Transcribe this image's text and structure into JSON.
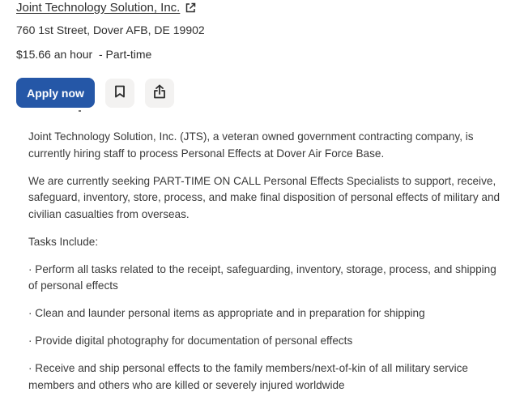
{
  "job": {
    "company": "Joint Technology Solution, Inc.",
    "company_link_icon": "external-link-icon",
    "address": "760 1st Street, Dover AFB, DE 19902",
    "salary": "$15.66 an hour",
    "job_type": " - Part-time"
  },
  "actions": {
    "apply_label": "Apply now",
    "save_icon": "bookmark-icon",
    "share_icon": "share-icon",
    "accent_color": "#2557a7"
  },
  "description": {
    "paragraphs": [
      "Joint Technology Solution, Inc. (JTS), a veteran owned government contracting company, is currently hiring staff to process Personal Effects at Dover Air Force Base.",
      "We are currently seeking PART-TIME ON CALL Personal Effects Specialists to support, receive, safeguard, inventory, store, process, and make final disposition of personal effects of military and civilian casualties from overseas.",
      "Tasks Include:",
      "· Perform all tasks related to the receipt, safeguarding, inventory, storage, process, and shipping of personal effects",
      "· Clean and launder personal items as appropriate and in preparation for shipping",
      "· Provide digital photography for documentation of personal effects",
      "· Receive and ship personal effects to the family members/next-of-kin of all military service members and others who are killed or severely injured worldwide"
    ]
  }
}
